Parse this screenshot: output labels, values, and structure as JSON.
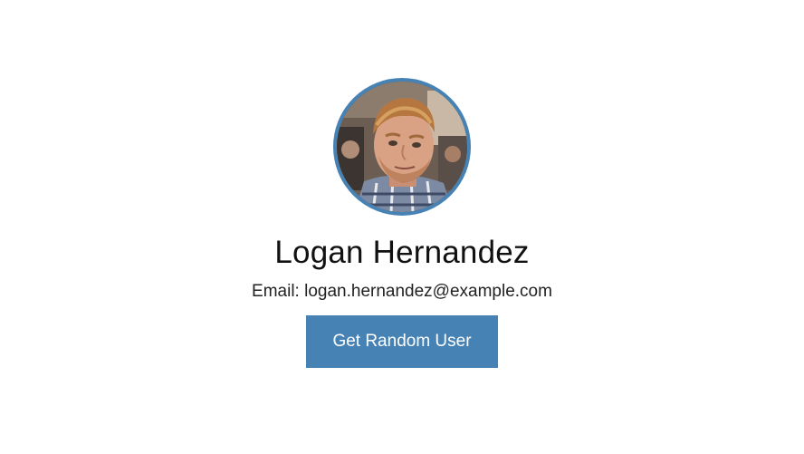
{
  "user": {
    "name": "Logan Hernandez",
    "email_label": "Email: logan.hernandez@example.com"
  },
  "actions": {
    "get_random_user_label": "Get Random User"
  },
  "theme": {
    "accent": "#4682b4",
    "background": "#ffffff"
  }
}
